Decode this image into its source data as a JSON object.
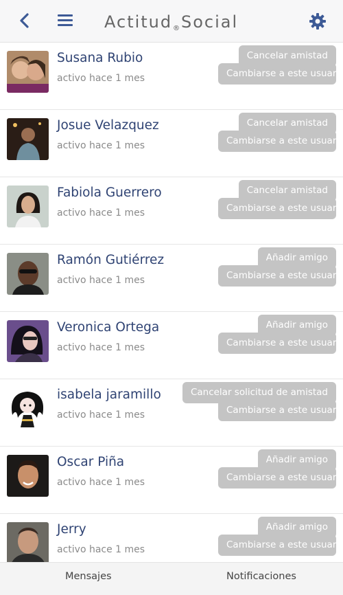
{
  "header": {
    "logo_part1": "Actitud",
    "logo_reg": "®",
    "logo_part2": "Social",
    "back_icon": "chevron-left-icon",
    "menu_icon": "hamburger-menu-icon",
    "settings_icon": "gear-icon",
    "icon_color": "#3d5a96"
  },
  "users": [
    {
      "name": "Susana Rubio",
      "status": "activo hace 1 mes",
      "action": "Cancelar amistad",
      "switch": "Cambiarse a este usuario"
    },
    {
      "name": "Josue Velazquez",
      "status": "activo hace 1 mes",
      "action": "Cancelar amistad",
      "switch": "Cambiarse a este usuario"
    },
    {
      "name": "Fabiola Guerrero",
      "status": "activo hace 1 mes",
      "action": "Cancelar amistad",
      "switch": "Cambiarse a este usuario"
    },
    {
      "name": "Ramón Gutiérrez",
      "status": "activo hace 1 mes",
      "action": "Añadir amigo",
      "switch": "Cambiarse a este usuario"
    },
    {
      "name": "Veronica Ortega",
      "status": "activo hace 1 mes",
      "action": "Añadir amigo",
      "switch": "Cambiarse a este usuario"
    },
    {
      "name": "isabela jaramillo",
      "status": "activo hace 1 mes",
      "action": "Cancelar solicitud de amistad",
      "switch": "Cambiarse a este usuario"
    },
    {
      "name": "Oscar Piña",
      "status": "activo hace 1 mes",
      "action": "Añadir amigo",
      "switch": "Cambiarse a este usuario"
    },
    {
      "name": "Jerry",
      "status": "activo hace 1 mes",
      "action": "Añadir amigo",
      "switch": "Cambiarse a este usuario"
    }
  ],
  "bottom_nav": {
    "mensajes": "Mensajes",
    "notificaciones": "Notificaciones"
  }
}
